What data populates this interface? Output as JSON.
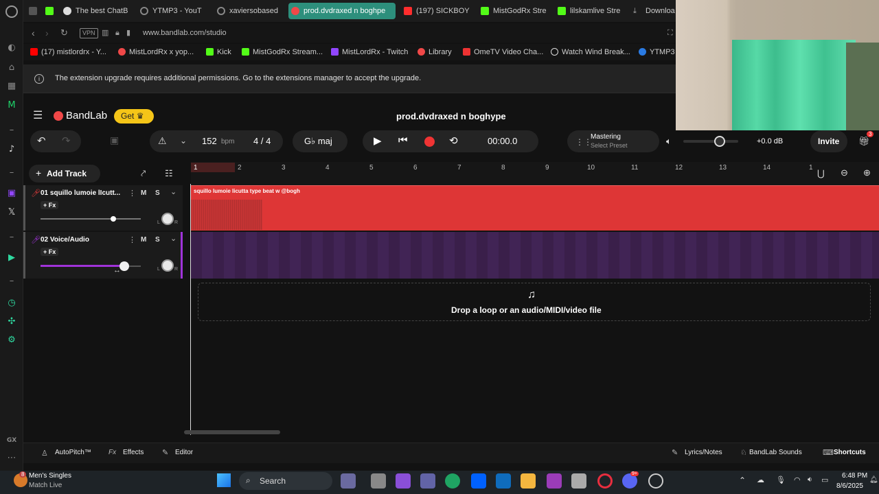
{
  "browser": {
    "tabs": [
      {
        "label": "",
        "color": "#666"
      },
      {
        "label": "",
        "color": "#53fc18"
      },
      {
        "label": "The best ChatB",
        "color": "#e8e8e8"
      },
      {
        "label": "YTMP3 - YouT",
        "color": "#888"
      },
      {
        "label": "xaviersobased",
        "color": "#888"
      },
      {
        "label": "prod.dvdraxed n boghpe",
        "color": "#f04848"
      },
      {
        "label": "(197) SICKBOY",
        "color": "#ff2d2d"
      },
      {
        "label": "MistGodRx Stre",
        "color": "#53fc18"
      },
      {
        "label": "lilskamlive Stre",
        "color": "#53fc18"
      },
      {
        "label": "Downloa",
        "color": "#aaa"
      }
    ],
    "vpn": "VPN",
    "url": "www.bandlab.com/studio",
    "bookmarks": [
      {
        "label": "(17) mistlordrx - Y...",
        "color": "#ff0000"
      },
      {
        "label": "MistLordRx x yop...",
        "color": "#f04848"
      },
      {
        "label": "Kick",
        "color": "#53fc18"
      },
      {
        "label": "MistGodRx Stream...",
        "color": "#53fc18"
      },
      {
        "label": "MistLordRx - Twitch",
        "color": "#9146ff"
      },
      {
        "label": "Library",
        "color": "#f04848"
      },
      {
        "label": "OmeTV Video Cha...",
        "color": "#e33"
      },
      {
        "label": "Watch Wind Break...",
        "color": "#ddd"
      },
      {
        "label": "YTMP3",
        "color": "#2a7be4"
      }
    ],
    "notice": "The extension upgrade requires additional permissions. Go to the extensions manager to accept the upgrade."
  },
  "app": {
    "brand": "BandLab",
    "get_label": "Get",
    "project_title": "prod.dvdraxed n boghype",
    "bpm_value": "152",
    "bpm_unit": "bpm",
    "time_sig": "4 / 4",
    "key": "G♭ maj",
    "time": "00:00.0",
    "mastering_title": "Mastering",
    "mastering_sub": "Select Preset",
    "volume_db": "+0.0 dB",
    "invite_label": "Invite",
    "gift_badge": "3",
    "add_track_label": "Add Track",
    "accent": "#f04848"
  },
  "ruler": [
    "1",
    "2",
    "3",
    "4",
    "5",
    "6",
    "7",
    "8",
    "9",
    "10",
    "11",
    "12",
    "13",
    "14",
    "1"
  ],
  "tracks": [
    {
      "name": "01  squillo lumoie lIcutt...",
      "fx": "+ Fx",
      "mute": "M",
      "solo": "S",
      "clip_label": "squillo lumoie licutta type beat w @bogh",
      "volume_level": 0.75,
      "color": "#e23b3b"
    },
    {
      "name": "02  Voice/Audio",
      "fx": "+ Fx",
      "mute": "M",
      "solo": "S",
      "volume_level": 0.85,
      "color": "#a033d9"
    }
  ],
  "knob_labels": {
    "left": "L",
    "right": "R"
  },
  "drop_zone": "Drop a loop or an audio/MIDI/video file",
  "footer": {
    "autopitch": "AutoPitch™",
    "fx_prefix": "Fx",
    "effects": "Effects",
    "editor": "Editor",
    "lyrics": "Lyrics/Notes",
    "sounds": "BandLab Sounds",
    "shortcuts": "Shortcuts"
  },
  "sidebar_bottom": "GX",
  "taskbar": {
    "notif_badge": "8",
    "news_title": "Men's Singles",
    "news_sub": "Match Live",
    "search_label": "Search",
    "discord_badge": "9+",
    "time": "6:48 PM",
    "date": "8/6/2025"
  }
}
